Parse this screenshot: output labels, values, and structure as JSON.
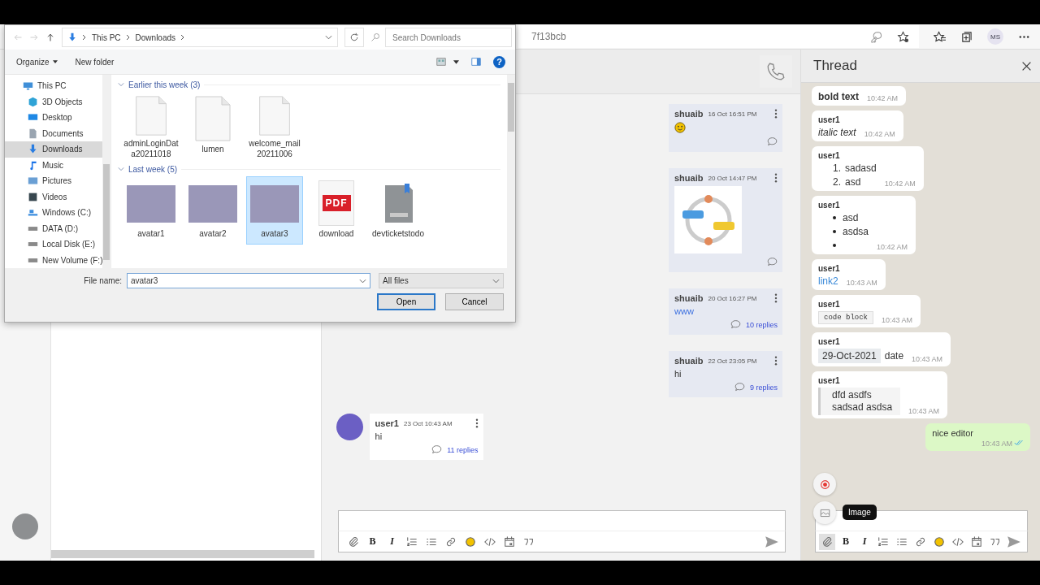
{
  "browser": {
    "address": "7f13bcb",
    "profile_initials": "MS"
  },
  "chat": {
    "messages": [
      {
        "own": true,
        "author": "shuaib",
        "time": "16 Oct 16:51 PM",
        "kind": "emoji"
      },
      {
        "own": true,
        "author": "shuaib",
        "time": "20 Oct 14:47 PM",
        "kind": "image"
      },
      {
        "own": true,
        "author": "shuaib",
        "time": "20 Oct 16:27 PM",
        "kind": "link",
        "text": "www",
        "replies": "10 replies"
      },
      {
        "own": true,
        "author": "shuaib",
        "time": "22 Oct 23:05 PM",
        "kind": "text",
        "text": "hi",
        "replies": "9 replies"
      },
      {
        "own": false,
        "author": "user1",
        "time": "23 Oct 10:43 AM",
        "kind": "text",
        "text": "hi",
        "replies": "11 replies"
      }
    ],
    "composer": {
      "tools": [
        {
          "kind": "attach"
        },
        {
          "kind": "bold",
          "label": "B"
        },
        {
          "kind": "italic",
          "label": "I"
        },
        {
          "kind": "ordered"
        },
        {
          "kind": "bullet"
        },
        {
          "kind": "link"
        },
        {
          "kind": "emoji"
        },
        {
          "kind": "code"
        },
        {
          "kind": "calendar"
        },
        {
          "kind": "quote"
        }
      ]
    }
  },
  "thread": {
    "title": "Thread",
    "messages": [
      {
        "kind": "bold",
        "text": "bold text",
        "time": "10:42 AM"
      },
      {
        "kind": "italic",
        "author": "user1",
        "text": "italic text",
        "time": "10:42 AM"
      },
      {
        "kind": "ordered",
        "author": "user1",
        "items": [
          {
            "marker": "1.",
            "text": "sadasd"
          },
          {
            "marker": "2.",
            "text": "asd"
          }
        ],
        "time": "10:42 AM"
      },
      {
        "kind": "bullet",
        "author": "user1",
        "items": [
          "asd",
          "asdsa"
        ],
        "empty_bullet": true,
        "time": "10:42 AM"
      },
      {
        "kind": "link",
        "author": "user1",
        "text": "link2",
        "time": "10:43 AM"
      },
      {
        "kind": "code",
        "author": "user1",
        "text": "code block",
        "time": "10:43 AM"
      },
      {
        "kind": "date",
        "author": "user1",
        "date": "29-Oct-2021",
        "text": "date",
        "time": "10:43 AM"
      },
      {
        "kind": "quote",
        "author": "user1",
        "lines": [
          "dfd asdfs",
          "sadsad asdsa"
        ],
        "time": "10:43 AM"
      },
      {
        "kind": "own",
        "text": "nice editor",
        "time": "10:43 AM",
        "read": true
      }
    ],
    "tooltip": "Image",
    "composer": {
      "tools": [
        {
          "kind": "attach",
          "highlighted": true
        },
        {
          "kind": "bold",
          "label": "B",
          "highlighted": false
        },
        {
          "kind": "italic",
          "label": "I",
          "highlighted": false
        },
        {
          "kind": "ordered",
          "highlighted": false
        },
        {
          "kind": "bullet",
          "highlighted": false
        },
        {
          "kind": "link",
          "highlighted": false
        },
        {
          "kind": "emoji",
          "highlighted": false
        },
        {
          "kind": "code",
          "highlighted": false
        },
        {
          "kind": "calendar",
          "highlighted": false
        },
        {
          "kind": "quote",
          "highlighted": false
        }
      ]
    }
  },
  "dialog": {
    "nav": {
      "back_disabled": true,
      "forward_disabled": true
    },
    "path": [
      "This PC",
      "Downloads"
    ],
    "search_placeholder": "Search Downloads",
    "toolbar": [
      "Organize",
      "New folder"
    ],
    "help": "?",
    "sidebar": [
      {
        "label": "This PC",
        "selected": false,
        "children": [
          {
            "label": "3D Objects",
            "selected": false
          },
          {
            "label": "Desktop",
            "selected": false
          },
          {
            "label": "Documents",
            "selected": false
          },
          {
            "label": "Downloads",
            "selected": true
          },
          {
            "label": "Music",
            "selected": false
          },
          {
            "label": "Pictures",
            "selected": false
          },
          {
            "label": "Videos",
            "selected": false
          },
          {
            "label": "Windows (C:)",
            "selected": false
          },
          {
            "label": "DATA (D:)",
            "selected": false
          },
          {
            "label": "Local Disk (E:)",
            "selected": false
          },
          {
            "label": "New Volume (F:)",
            "selected": false
          }
        ]
      }
    ],
    "groups": [
      {
        "title": "Earlier this week (3)",
        "files": [
          {
            "name": "adminLoginData20211018",
            "kind": "document",
            "selected": false
          },
          {
            "name": "lumen",
            "kind": "document",
            "selected": false
          },
          {
            "name": "welcome_mail20211006",
            "kind": "document",
            "selected": false
          }
        ]
      },
      {
        "title": "Last week (5)",
        "files": [
          {
            "name": "avatar1",
            "kind": "photo",
            "selected": false
          },
          {
            "name": "avatar2",
            "kind": "photo",
            "selected": false
          },
          {
            "name": "avatar3",
            "kind": "photo",
            "selected": true
          },
          {
            "name": "download",
            "kind": "pdf",
            "badge": "PDF",
            "selected": false
          },
          {
            "name": "devticketstodo",
            "kind": "archive",
            "selected": false
          }
        ]
      }
    ],
    "file_name_label": "File name:",
    "file_name": "avatar3",
    "filter": "All files",
    "buttons": [
      {
        "label": "Open",
        "default": true
      },
      {
        "label": "Cancel",
        "default": false
      }
    ]
  }
}
